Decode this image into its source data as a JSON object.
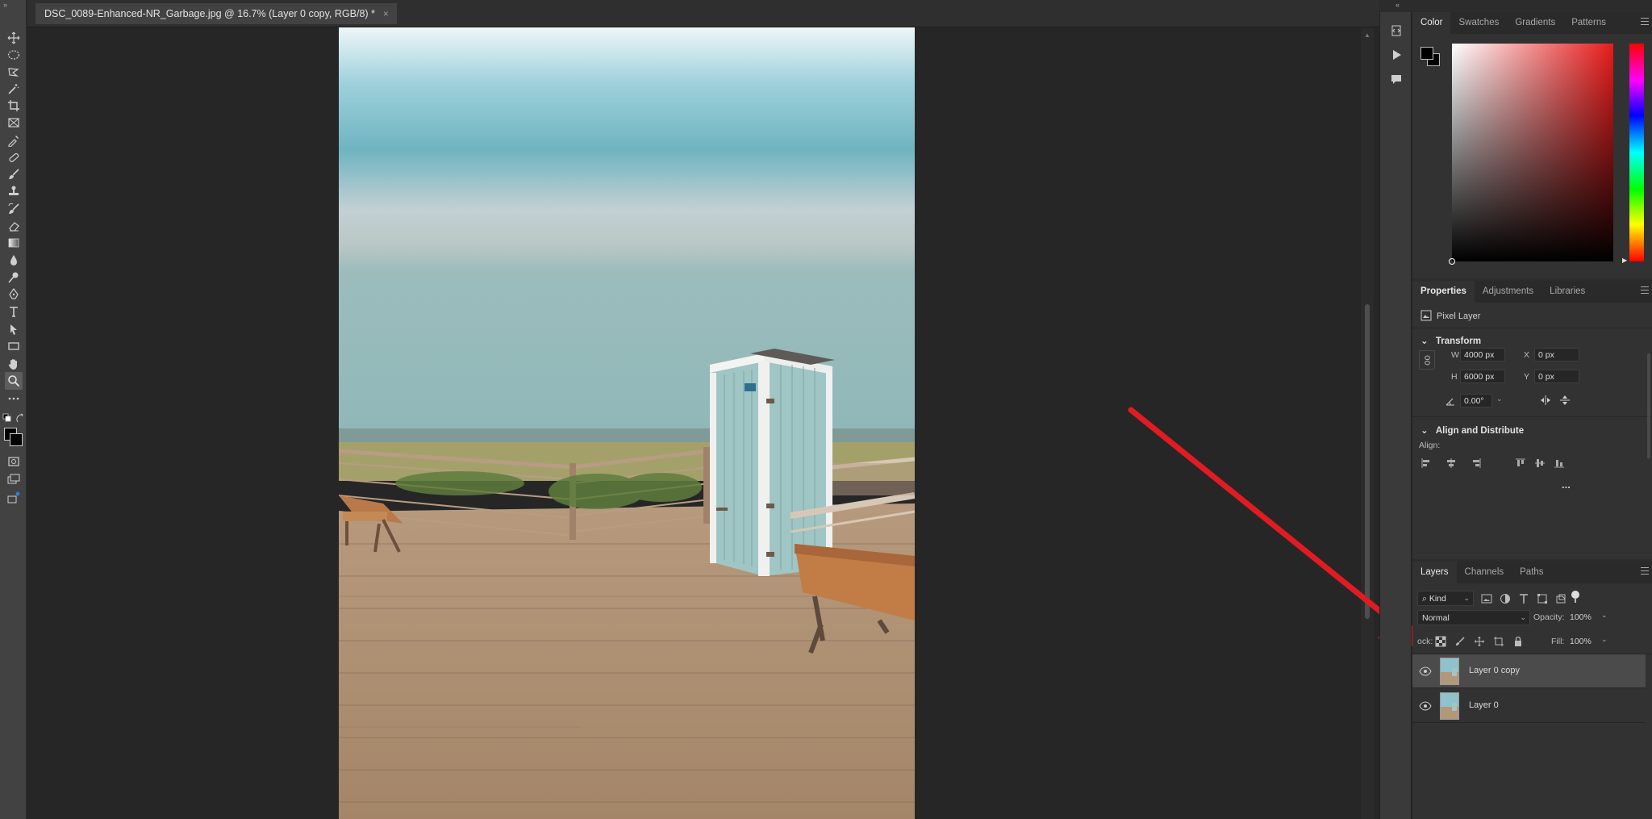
{
  "document": {
    "tab_title": "DSC_0089-Enhanced-NR_Garbage.jpg @ 16.7% (Layer 0 copy, RGB/8) *",
    "close_symbol": "×"
  },
  "tools": [
    "move-tool",
    "marquee-tool",
    "lasso-tool",
    "magic-wand-tool",
    "crop-tool",
    "frame-tool",
    "eyedropper-tool",
    "healing-brush-tool",
    "brush-tool",
    "clone-stamp-tool",
    "history-brush-tool",
    "eraser-tool",
    "gradient-tool",
    "blur-tool",
    "dodge-tool",
    "pen-tool",
    "type-tool",
    "path-selection-tool",
    "rectangle-tool",
    "hand-tool",
    "zoom-tool",
    "more-tools"
  ],
  "active_tool": "zoom-tool",
  "color_panel": {
    "tabs": [
      "Color",
      "Swatches",
      "Gradients",
      "Patterns"
    ],
    "active_tab": "Color",
    "foreground": "#000000",
    "background": "#000000",
    "hue_color": "#e81b1b"
  },
  "properties_panel": {
    "tabs": [
      "Properties",
      "Adjustments",
      "Libraries"
    ],
    "active_tab": "Properties",
    "layer_type": "Pixel Layer",
    "transform": {
      "title": "Transform",
      "w_label": "W",
      "w_value": "4000 px",
      "h_label": "H",
      "h_value": "6000 px",
      "x_label": "X",
      "x_value": "0 px",
      "y_label": "Y",
      "y_value": "0 px",
      "angle_value": "0.00°"
    },
    "align": {
      "title": "Align and Distribute",
      "label": "Align:",
      "more": "..."
    }
  },
  "layers_panel": {
    "tabs": [
      "Layers",
      "Channels",
      "Paths"
    ],
    "active_tab": "Layers",
    "filter_kind": "Kind",
    "blend_mode": "Normal",
    "opacity_label": "Opacity:",
    "opacity_value": "100%",
    "lock_label": "ock:",
    "fill_label": "Fill:",
    "fill_value": "100%",
    "layers": [
      {
        "name": "Layer 0 copy",
        "selected": true,
        "visible": true
      },
      {
        "name": "Layer 0",
        "selected": false,
        "visible": true
      }
    ]
  },
  "colors": {
    "annotation_arrow": "#e11b22",
    "panel_bg": "#323232",
    "selected_layer": "#4b4b4b"
  }
}
